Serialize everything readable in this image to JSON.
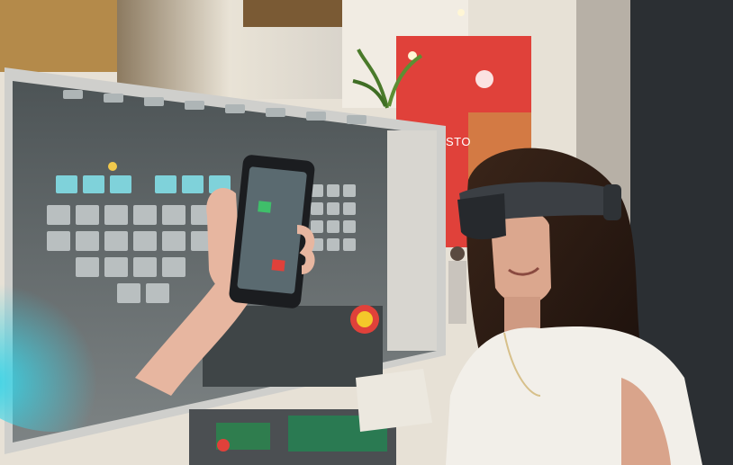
{
  "photo": {
    "subject": "woman-wearing-mixed-reality-headset",
    "screen_content": "hand-holding-phone-over-cnc-control-panel",
    "colors": {
      "booth_red": "#e0413a",
      "screen_bezel": "#c9c9c6",
      "panel_gray": "#6f7476",
      "key_cyan": "#7fd2da",
      "hair": "#2a1a14",
      "blouse": "#f2efe9",
      "headset": "#3b3f44",
      "wood": "#d08a4a"
    },
    "booth_sign_text": "STO"
  }
}
